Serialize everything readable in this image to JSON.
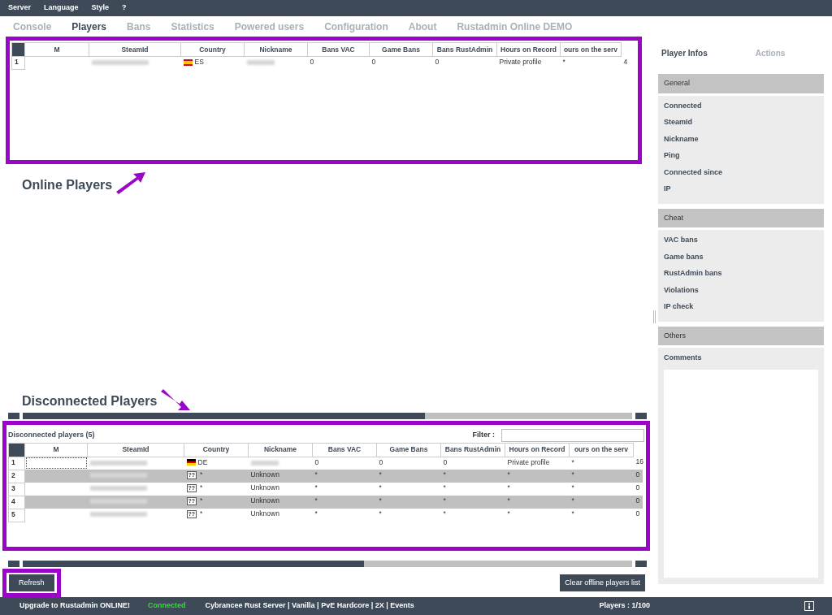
{
  "menu": [
    {
      "label": "Server"
    },
    {
      "label": "Language"
    },
    {
      "label": "Style"
    },
    {
      "label": "?"
    }
  ],
  "tabs": [
    {
      "label": "Console",
      "selected": false
    },
    {
      "label": "Players",
      "selected": true
    },
    {
      "label": "Bans",
      "selected": false
    },
    {
      "label": "Statistics",
      "selected": false
    },
    {
      "label": "Powered users",
      "selected": false
    },
    {
      "label": "Configuration",
      "selected": false
    },
    {
      "label": "About",
      "selected": false
    },
    {
      "label": "Rustadmin Online DEMO",
      "selected": false
    }
  ],
  "online_grid": {
    "highlighted": true,
    "columns": [
      "M",
      "SteamId",
      "Country",
      "Nickname",
      "Bans VAC",
      "Game Bans",
      "Bans RustAdmin",
      "Hours on Record",
      "ours on the serv"
    ],
    "rows": [
      {
        "number": "1",
        "focused": false,
        "flag": {
          "kind": "es"
        },
        "country": "ES",
        "values": [
          "0",
          "0",
          "0",
          "Private profile",
          "*",
          "4"
        ]
      }
    ]
  },
  "annotations": [
    {
      "text": "Online Players",
      "kind": "arrow-up"
    },
    {
      "text": "Disconnected Players",
      "kind": "arrow-down"
    }
  ],
  "disconnected": {
    "highlighted": true,
    "title": "Disconnected players (5)",
    "filter": {
      "label": "Filter :"
    },
    "columns": [
      "M",
      "SteamId",
      "Country",
      "Nickname",
      "Bans VAC",
      "Game Bans",
      "Bans RustAdmin",
      "Hours on Record",
      "ours on the serv"
    ],
    "rows": [
      {
        "number": "1",
        "focused": true,
        "flag": {
          "kind": "de"
        },
        "country": "DE",
        "values": [
          "0",
          "0",
          "0",
          "Private profile",
          "*",
          "16"
        ]
      },
      {
        "number": "2",
        "focused": false,
        "flag": {
          "kind": "unknown",
          "label": "??"
        },
        "country": "*",
        "nickname": "Unknown",
        "values": [
          "*",
          "*",
          "*",
          "*",
          "*",
          "0"
        ]
      },
      {
        "number": "3",
        "focused": false,
        "flag": {
          "kind": "unknown",
          "label": "??"
        },
        "country": "*",
        "nickname": "Unknown",
        "values": [
          "*",
          "*",
          "*",
          "*",
          "*",
          "0"
        ]
      },
      {
        "number": "4",
        "focused": false,
        "flag": {
          "kind": "unknown",
          "label": "??"
        },
        "country": "*",
        "nickname": "Unknown",
        "values": [
          "*",
          "*",
          "*",
          "*",
          "*",
          "0"
        ]
      },
      {
        "number": "5",
        "focused": false,
        "flag": {
          "kind": "unknown",
          "label": "??"
        },
        "country": "*",
        "nickname": "Unknown",
        "values": [
          "*",
          "*",
          "*",
          "*",
          "*",
          "0"
        ]
      }
    ]
  },
  "refresh_button": {
    "label": "Refresh",
    "highlighted": true
  },
  "clear_button": {
    "label": "Clear offline players list"
  },
  "side_tabs": [
    {
      "label": "Player Infos",
      "selected": true
    },
    {
      "label": "Actions",
      "selected": false
    }
  ],
  "sections": [
    {
      "title": "General",
      "kind": "fields",
      "fields": [
        "Connected",
        "SteamId",
        "Nickname",
        "Ping",
        "Connected since",
        "IP"
      ]
    },
    {
      "title": "Cheat",
      "kind": "fields",
      "fields": [
        "VAC bans",
        "Game bans",
        "RustAdmin bans",
        "Violations",
        "IP check"
      ]
    },
    {
      "title": "Others",
      "kind": "comments",
      "fields": [
        "Comments"
      ]
    }
  ],
  "status_bar": {
    "upgrade": "Upgrade to Rustadmin ONLINE!",
    "connection": "Connected",
    "server": "Cybrancee Rust Server | Vanilla | PvE Hardcore | 2X | Events",
    "players": "Players : 1/100"
  }
}
